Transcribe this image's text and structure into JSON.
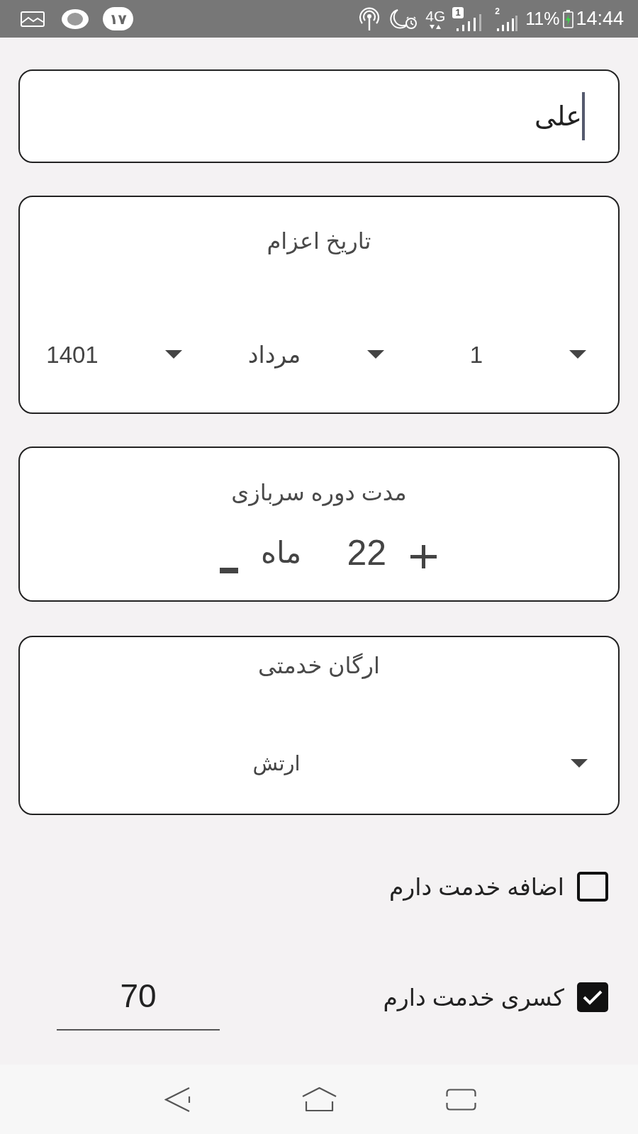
{
  "status_bar": {
    "notification_badge": "۱۷",
    "network": "4G",
    "sim_1_badge": "1",
    "sim_2_label": "2",
    "battery": "11%",
    "charging": true,
    "time": "14:44"
  },
  "name_field": {
    "value": "علی",
    "focused": true
  },
  "dispatch_date": {
    "title": "تاریخ اعزام",
    "dropdowns": [
      {
        "value": "1"
      },
      {
        "value": "مرداد"
      },
      {
        "value": "1401"
      }
    ]
  },
  "service_duration": {
    "title": "مدت دوره سربازی",
    "value": "22",
    "unit": "ماه"
  },
  "service_branch": {
    "title": "ارگان خدمتی",
    "dropdown": {
      "value": "ارتش"
    }
  },
  "options": [
    {
      "label": "اضافه خدمت دارم",
      "checked": false
    },
    {
      "label": "کسری خدمت دارم",
      "checked": true,
      "field_value": "70"
    }
  ]
}
